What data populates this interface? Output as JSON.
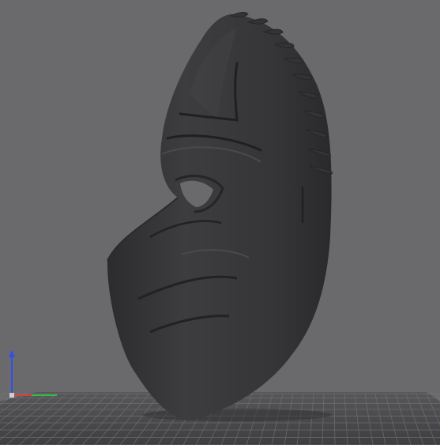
{
  "viewport": {
    "background_color": "#6a6a6d",
    "model": {
      "description_name": "mask-model",
      "color": "#3a3a3c"
    },
    "build_plate": {
      "color": "#4a4a4d",
      "grid_color": "#7a7a7e"
    },
    "axis_gizmo": {
      "x_color": "#e23a3a",
      "y_color": "#2fbf4a",
      "z_color": "#3050e8"
    }
  }
}
